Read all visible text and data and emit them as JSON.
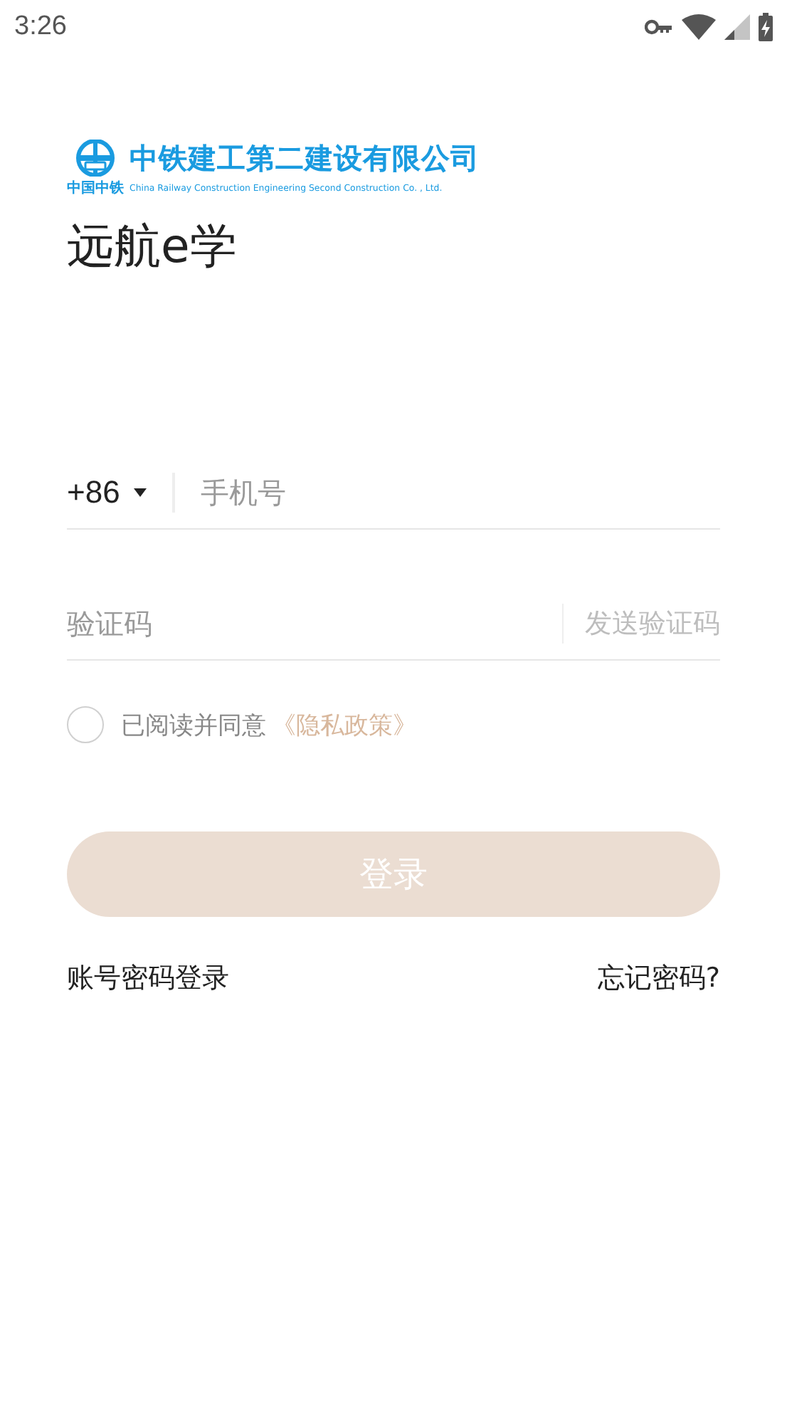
{
  "status_bar": {
    "time": "3:26"
  },
  "logo": {
    "company_name": "中铁建工第二建设有限公司",
    "short_name": "中国中铁",
    "english_name": "China Railway Construction Engineering Second Construction Co. , Ltd."
  },
  "app_title": "远航e学",
  "phone": {
    "country_code": "+86",
    "placeholder": "手机号"
  },
  "code": {
    "placeholder": "验证码",
    "send_button": "发送验证码"
  },
  "agreement": {
    "checked": false,
    "text": "已阅读并同意",
    "link": "《隐私政策》"
  },
  "login_button": {
    "label": "登录",
    "disabled": true
  },
  "links": {
    "password_login": "账号密码登录",
    "forgot_password": "忘记密码?"
  }
}
